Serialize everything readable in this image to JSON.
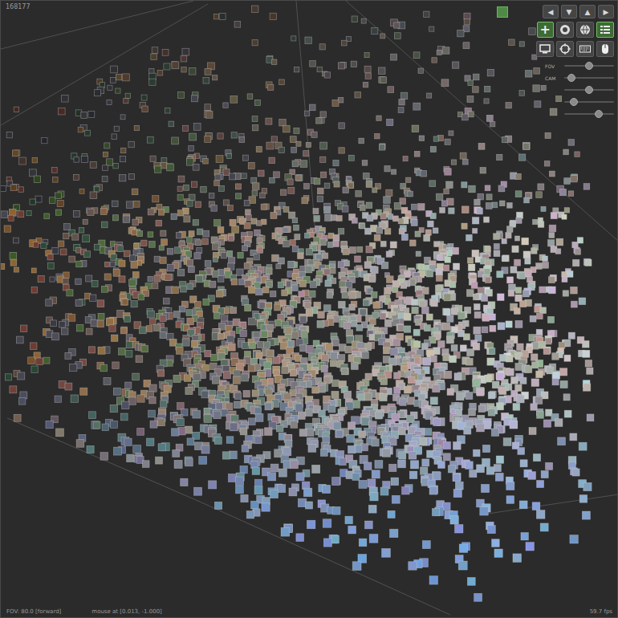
{
  "hud": {
    "count": "168177",
    "fov_status": "FOV: 80.0 [forward]",
    "mouse": "mouse at [0.013, -1.000]",
    "fps": "59.7 fps"
  },
  "toolbar": {
    "indicator": {
      "on": true
    },
    "nav_buttons": [
      {
        "label": "◀",
        "selected": false
      },
      {
        "label": "▼",
        "selected": false
      },
      {
        "label": "▲",
        "selected": false
      },
      {
        "label": "▶",
        "selected": false
      }
    ],
    "mode_buttons": [
      {
        "kind": "add",
        "label": "+",
        "selected": true
      },
      {
        "kind": "record",
        "selected": false
      },
      {
        "kind": "globe",
        "selected": false
      },
      {
        "kind": "list",
        "selected": true
      }
    ],
    "view_buttons": [
      {
        "kind": "monitor",
        "selected": false
      },
      {
        "kind": "target",
        "selected": false
      },
      {
        "kind": "keyboard",
        "selected": false
      },
      {
        "kind": "mouse",
        "selected": false
      }
    ],
    "sliders": [
      {
        "label": "FOV",
        "level": 0.5
      },
      {
        "label": "CAM",
        "level": 0.15
      },
      {
        "label": "",
        "level": 0.5
      },
      {
        "label": "",
        "level": 0.2
      },
      {
        "label": "",
        "level": 0.7
      }
    ]
  }
}
